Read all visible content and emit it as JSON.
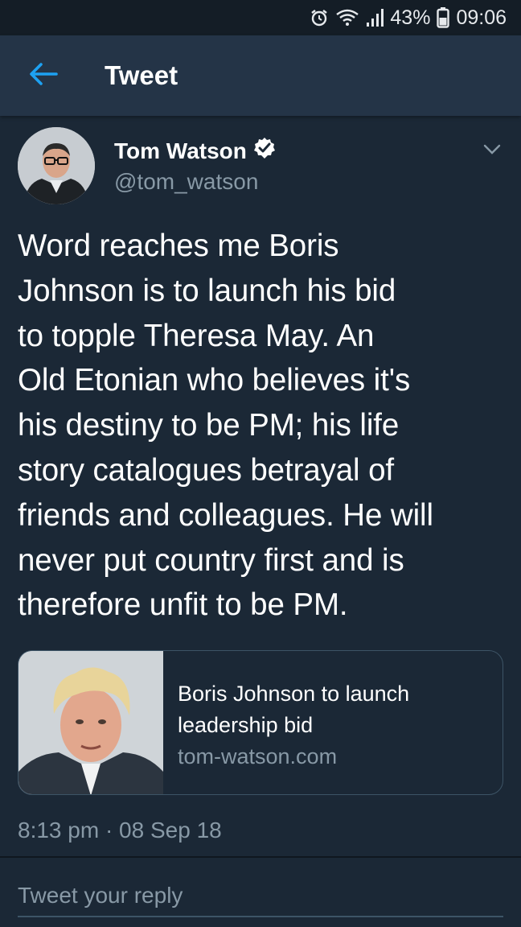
{
  "status_bar": {
    "battery": "43%",
    "time": "09:06",
    "icons": [
      "alarm-icon",
      "wifi-icon",
      "signal-icon",
      "battery-icon"
    ]
  },
  "app_bar": {
    "title": "Tweet",
    "back_icon": "arrow-left-icon",
    "accent_color": "#1da1f2"
  },
  "tweet": {
    "author_name": "Tom Watson",
    "author_handle": "@tom_watson",
    "verified": true,
    "text_lines": [
      "Word reaches me Boris",
      "Johnson is to launch his bid",
      "to topple Theresa May. An",
      "Old Etonian who believes it's",
      "his destiny to be PM; his life",
      "story catalogues betrayal of",
      "friends and colleagues. He will",
      "never put country first and is",
      "therefore unfit to be PM."
    ],
    "link_card": {
      "title_lines": [
        "Boris Johnson to launch",
        "leadership bid"
      ],
      "domain": "tom-watson.com"
    },
    "timestamp": "8:13 pm · 08 Sep 18"
  },
  "reply": {
    "placeholder": "Tweet your reply"
  }
}
